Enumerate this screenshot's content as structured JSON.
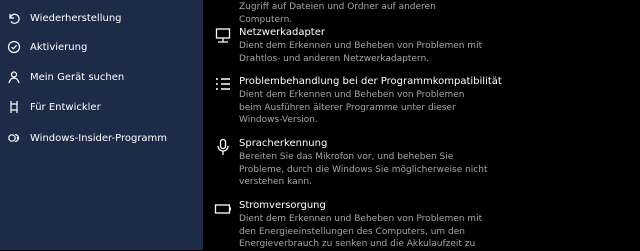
{
  "sidebar": {
    "items": [
      {
        "label": "Wiederherstellung",
        "icon": "recovery-icon"
      },
      {
        "label": "Aktivierung",
        "icon": "activation-icon"
      },
      {
        "label": "Mein Gerät suchen",
        "icon": "find-device-icon"
      },
      {
        "label": "Für Entwickler",
        "icon": "developer-icon"
      },
      {
        "label": "Windows-Insider-Programm",
        "icon": "insider-icon"
      }
    ]
  },
  "main": {
    "top_partial_desc": "Zugriff auf Dateien und Ordner auf anderen Computern.",
    "troubleshooters": [
      {
        "title": "Netzwerkadapter",
        "description": "Dient dem Erkennen und Beheben von Problemen mit Drahtlos- und anderen Netzwerkadaptern.",
        "icon": "network-adapter-icon"
      },
      {
        "title": "Problembehandlung bei der Programmkompatibilität",
        "description": "Dient dem Erkennen und Beheben von Problemen beim Ausführen älterer Programme unter dieser Windows-Version.",
        "icon": "compatibility-list-icon"
      },
      {
        "title": "Spracherkennung",
        "description": "Bereiten Sie das Mikrofon vor, und beheben Sie Probleme, durch die Windows Sie möglicherweise nicht verstehen kann.",
        "icon": "microphone-icon"
      },
      {
        "title": "Stromversorgung",
        "description": "Dient dem Erkennen und Beheben von Problemen mit den Energieeinstellungen des Computers, um den Energieverbrauch zu senken und die Akkulaufzeit zu",
        "icon": "battery-icon"
      }
    ]
  },
  "colors": {
    "sidebar_bg": "#1d2a48",
    "main_bg": "#000000",
    "desc_text": "#a6a6a6"
  }
}
